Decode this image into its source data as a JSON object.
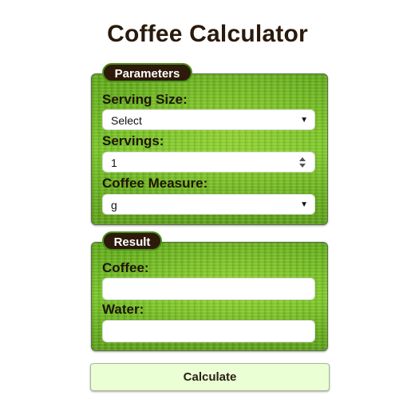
{
  "header": {
    "title": "Coffee Calculator"
  },
  "parameters": {
    "legend": "Parameters",
    "serving_size": {
      "label": "Serving Size:",
      "value": "Select"
    },
    "servings": {
      "label": "Servings:",
      "value": "1"
    },
    "coffee_measure": {
      "label": "Coffee Measure:",
      "value": "g"
    }
  },
  "result": {
    "legend": "Result",
    "coffee": {
      "label": "Coffee:",
      "value": ""
    },
    "water": {
      "label": "Water:",
      "value": ""
    }
  },
  "actions": {
    "calculate_label": "Calculate"
  },
  "icons": {
    "dropdown": "chevron-down-icon",
    "spinner": "number-spinner-icon"
  },
  "colors": {
    "panel_green": "#67b21e",
    "legend_bg": "#2e1a0a",
    "button_bg": "#eaffd4",
    "title_text": "#2a1a0c"
  }
}
